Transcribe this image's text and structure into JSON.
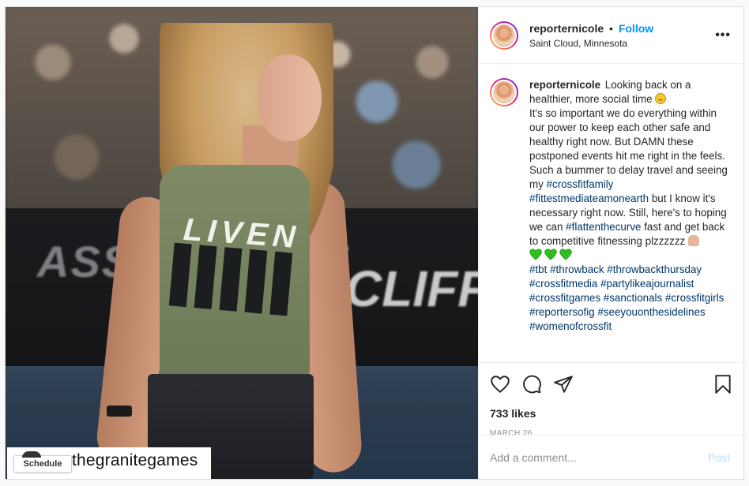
{
  "post": {
    "username": "reporternicole",
    "follow_label": "Follow",
    "dot": "•",
    "location": "Saint Cloud, Minnesota",
    "more_label": "•••",
    "caption": {
      "username": "reporternicole",
      "text_1": "Looking back on a healthier, more social time",
      "text_2": "It's so important we do everything within our power to keep each other safe and healthy right now. But DAMN these postponed events hit me right in the feels. Such a bummer to delay travel and seeing my",
      "tag_crossfitfamily": "#crossfitfamily",
      "tag_fittestmedia": "#fittestmediateamonearth",
      "text_3": "but I know it's necessary right now. Still, here's to hoping we can",
      "tag_flatten": "#flattenthecurve",
      "text_4": "fast and get back to competitive fitnessing plzzzzzz",
      "hashtags": [
        "#tbt",
        "#throwback",
        "#throwbackthursday",
        "#crossfitmedia",
        "#partylikeajournalist",
        "#crossfitgames",
        "#sanctionals",
        "#crossfitgirls",
        "#reportersofig",
        "#seeyouonthesidelines",
        "#womenofcrossfit"
      ]
    },
    "likes": "733 likes",
    "date": "MARCH 26",
    "comment_placeholder": "Add a comment...",
    "post_label": "Post",
    "photo": {
      "shirt_word": "LIVEN",
      "banner_left": "ASSAU FITNE",
      "banner_right": "CLIFF",
      "tag_username": "thegranitegames",
      "schedule_label": "Schedule"
    }
  },
  "colors": {
    "accent": "#0095f6",
    "hashtag": "#00376b",
    "post_disabled": "#b2dffc",
    "muted": "#8e8e8e"
  },
  "icons": [
    "heart-icon",
    "comment-icon",
    "share-icon",
    "bookmark-icon",
    "more-options-icon"
  ]
}
